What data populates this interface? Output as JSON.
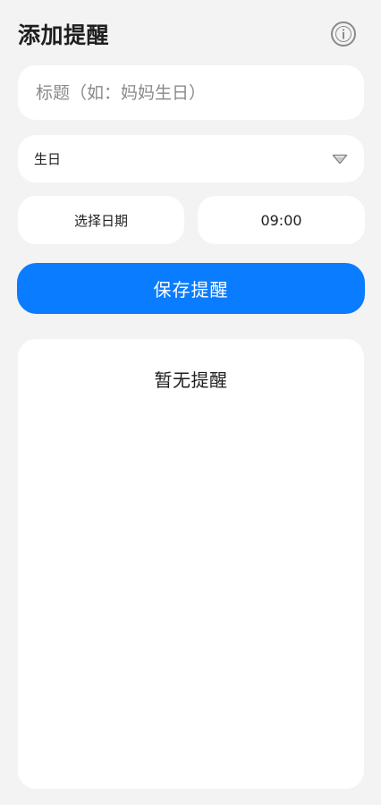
{
  "header": {
    "title": "添加提醒",
    "info_icon": "info-icon"
  },
  "form": {
    "title_placeholder": "标题（如：妈妈生日）",
    "title_value": "",
    "type_selected": "生日",
    "type_icon": "dropdown-triangle-icon",
    "date_label": "选择日期",
    "time_value": "09:00",
    "save_label": "保存提醒"
  },
  "reminders": {
    "empty_text": "暂无提醒",
    "items": []
  },
  "colors": {
    "accent": "#0a7cff",
    "background": "#f3f3f3",
    "card": "#ffffff"
  }
}
